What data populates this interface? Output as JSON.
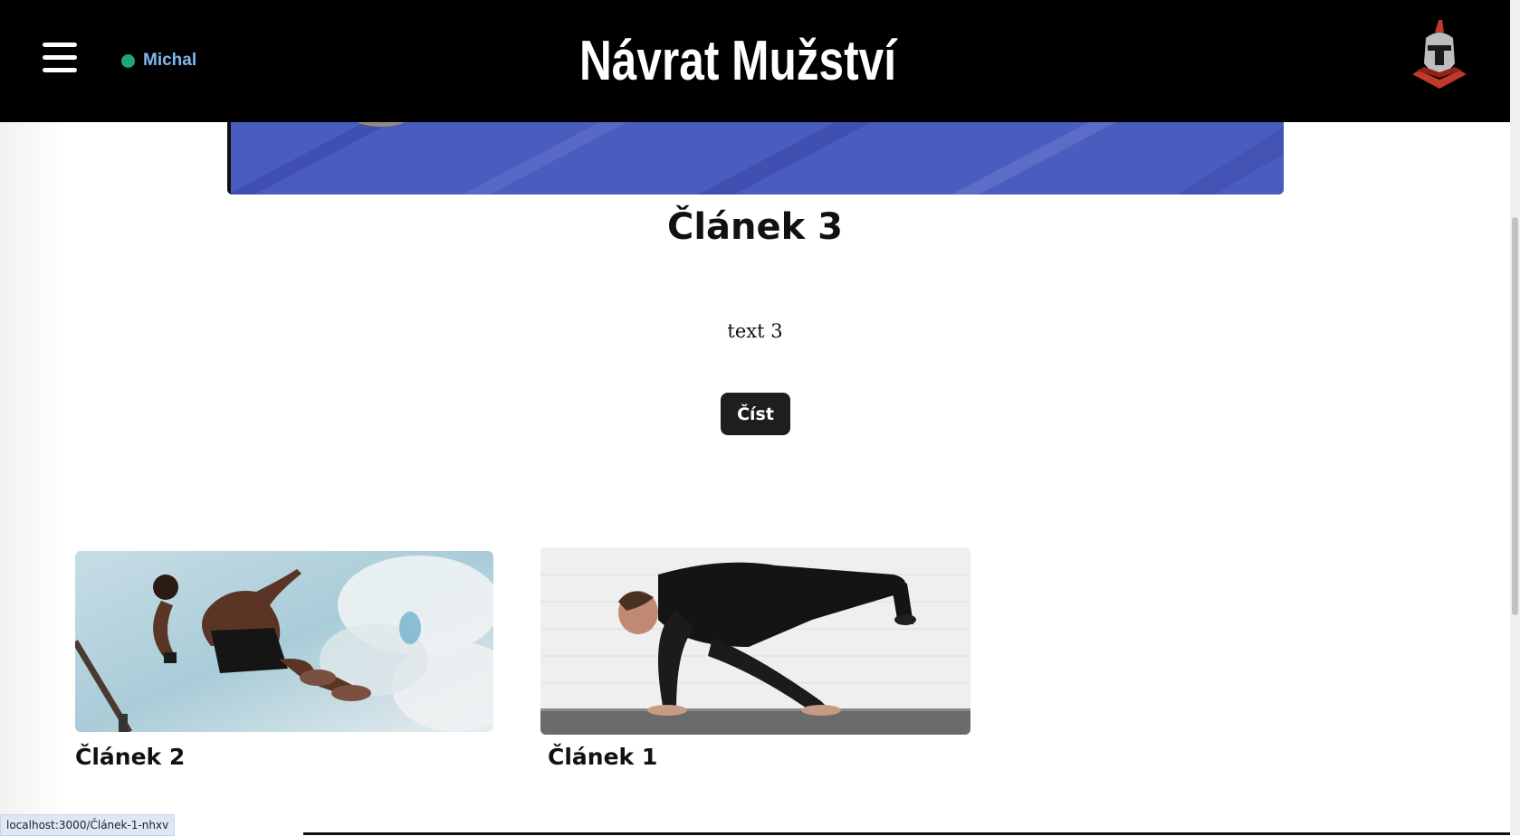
{
  "header": {
    "menu_icon": "hamburger-icon",
    "user_name": "Michal",
    "status_color": "#1fa67a",
    "site_title": "Návrat Mužství",
    "logo_icon": "spartan-helmet-icon"
  },
  "featured": {
    "title": "Článek 3",
    "text": "text 3",
    "read_label": "Číst"
  },
  "cards": [
    {
      "title": "Článek 2",
      "image": "man-jumping-sky-photo"
    },
    {
      "title": "Článek 1",
      "image": "man-one-arm-pushup-photo"
    }
  ],
  "status_bar": {
    "url": "localhost:3000/Článek-1-nhxv"
  },
  "colors": {
    "header_bg": "#000000",
    "button_bg": "#1e1e1e",
    "user_name": "#7fb8ee"
  }
}
